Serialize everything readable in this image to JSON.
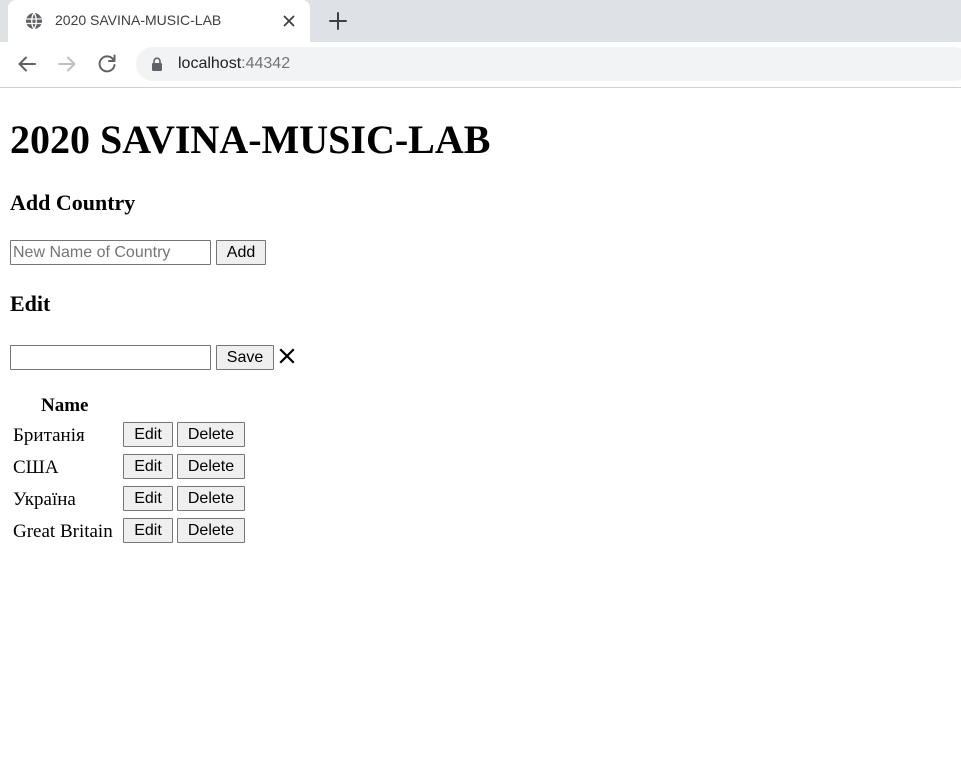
{
  "browser": {
    "tab": {
      "title": "2020 SAVINA-MUSIC-LAB",
      "favicon": "globe-icon",
      "close": "close-icon"
    },
    "new_tab": "plus-icon",
    "nav": {
      "back": "arrow-left-icon",
      "forward": "arrow-right-icon",
      "reload": "reload-icon"
    },
    "address_bar": {
      "host": "localhost",
      "port": ":44342",
      "security": "lock-icon"
    }
  },
  "page": {
    "title": "2020 SAVINA-MUSIC-LAB",
    "add_section": {
      "heading": "Add Country",
      "input_placeholder": "New Name of Country",
      "input_value": "",
      "button_label": "Add"
    },
    "edit_section": {
      "heading": "Edit",
      "input_value": "",
      "save_label": "Save",
      "cancel_glyph": "✕"
    },
    "table": {
      "column_header": "Name",
      "rows": [
        {
          "name": "Британія",
          "edit_label": "Edit",
          "delete_label": "Delete"
        },
        {
          "name": "США",
          "edit_label": "Edit",
          "delete_label": "Delete"
        },
        {
          "name": "Україна",
          "edit_label": "Edit",
          "delete_label": "Delete"
        },
        {
          "name": "Great Britain",
          "edit_label": "Edit",
          "delete_label": "Delete"
        }
      ]
    }
  },
  "colors": {
    "tabstrip_bg": "#dee1e6",
    "omnibox_bg": "#f1f3f4",
    "button_bg": "#efefef",
    "button_border": "#767676"
  }
}
